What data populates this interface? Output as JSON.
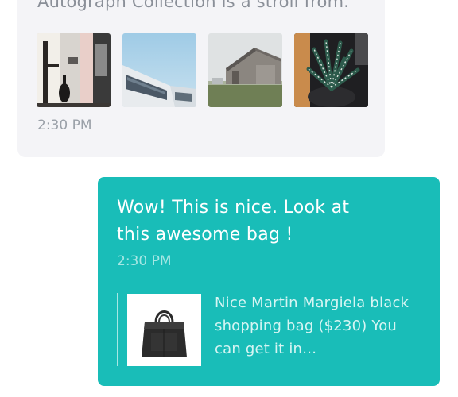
{
  "incoming": {
    "text": "Autograph Collection is a stroll from.",
    "photos": [
      {
        "name": "interior-vase"
      },
      {
        "name": "modern-building"
      },
      {
        "name": "barn-in-fog"
      },
      {
        "name": "succulent-plant"
      }
    ],
    "time": "2:30 PM"
  },
  "outgoing": {
    "text": "Wow! This is nice. Look at this awesome bag !",
    "time": "2:30 PM",
    "product": {
      "description": "Nice Martin Margiela black shopping bag ($230) You can get it in…"
    }
  },
  "colors": {
    "incoming_bg": "#f4f4f7",
    "outgoing_bg": "#19bdb8",
    "outgoing_text": "#ffffff",
    "outgoing_meta": "#a7e7e4"
  }
}
